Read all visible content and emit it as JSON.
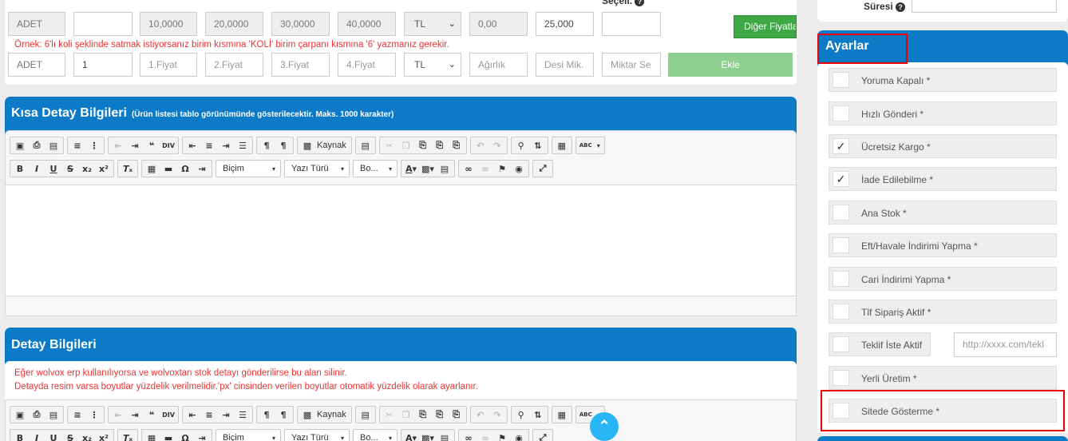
{
  "pricing": {
    "row1": {
      "unit": "ADET",
      "multiplier": "",
      "price1": "10,0000",
      "price2": "20,0000",
      "price3": "30,0000",
      "price4": "40,0000",
      "currency": "TL",
      "weight": "0,00",
      "desi": "25,000",
      "quantity": "",
      "other_prices_button": "Diğer Fiyatla",
      "top_label": "Seçeli."
    },
    "hint": "Örnek: 6'lı koli şeklinde satmak istiyorsanız birim kısmına 'KOLİ' birim çarpanı kısmına '6' yazmanız gerekir.",
    "row2": {
      "unit": "ADET",
      "multiplier": "1",
      "price1_placeholder": "1.Fiyat",
      "price2_placeholder": "2.Fiyat",
      "price3_placeholder": "3.Fiyat",
      "price4_placeholder": "4.Fiyat",
      "currency": "TL",
      "weight_placeholder": "Ağırlık",
      "desi_placeholder": "Desi Mik.",
      "quantity_placeholder": "Miktar Se",
      "add_button": "Ekle"
    }
  },
  "short_detail": {
    "title": "Kısa Detay Bilgileri",
    "subtitle": "(Ürün listesi tablo görünümünde gösterilecektir. Maks. 1000 karakter)"
  },
  "detail": {
    "title": "Detay Bilgileri",
    "warning1": "Eğer wolvox erp kullanılıyorsa ve wolvoxtan stok detayı gönderilirse bu alan silinir.",
    "warning2": "Detayda resim varsa boyutlar yüzdelik verilmelidir.'px' cinsinden verilen boyutlar otomatik yüzdelik olarak ayarlanır."
  },
  "editor": {
    "source_label": "Kaynak",
    "format_combo": "Biçim",
    "font_combo": "Yazı Türü",
    "size_combo": "Bo...",
    "div_label": "DIV",
    "abc_label": "ABC"
  },
  "right_panel": {
    "top_label": "Süresi",
    "title": "Ayarlar",
    "settings": [
      {
        "label": "Yoruma Kapalı *",
        "checked": false
      },
      {
        "label": "Hızlı Gönderi *",
        "checked": false
      },
      {
        "label": "Ücretsiz Kargo *",
        "checked": true
      },
      {
        "label": "İade Edilebilme *",
        "checked": true
      },
      {
        "label": "Ana Stok *",
        "checked": false
      },
      {
        "label": "Eft/Havale İndirimi Yapma *",
        "checked": false
      },
      {
        "label": "Cari İndirimi Yapma *",
        "checked": false
      },
      {
        "label": "Tlf Sipariş Aktif *",
        "checked": false
      },
      {
        "label": "Teklif İste Aktif",
        "checked": false
      },
      {
        "label": "Yerli Üretim *",
        "checked": false
      },
      {
        "label": "Sitede Gösterme *",
        "checked": false
      }
    ],
    "teklif_url_placeholder": "http://xxxx.com/tekl"
  },
  "colors": {
    "header_blue": "#0c7ac6",
    "error_red": "#e33333",
    "green_button": "#3fa846",
    "green_button_light": "#8dcf8f",
    "highlight_red": "#e00000"
  }
}
